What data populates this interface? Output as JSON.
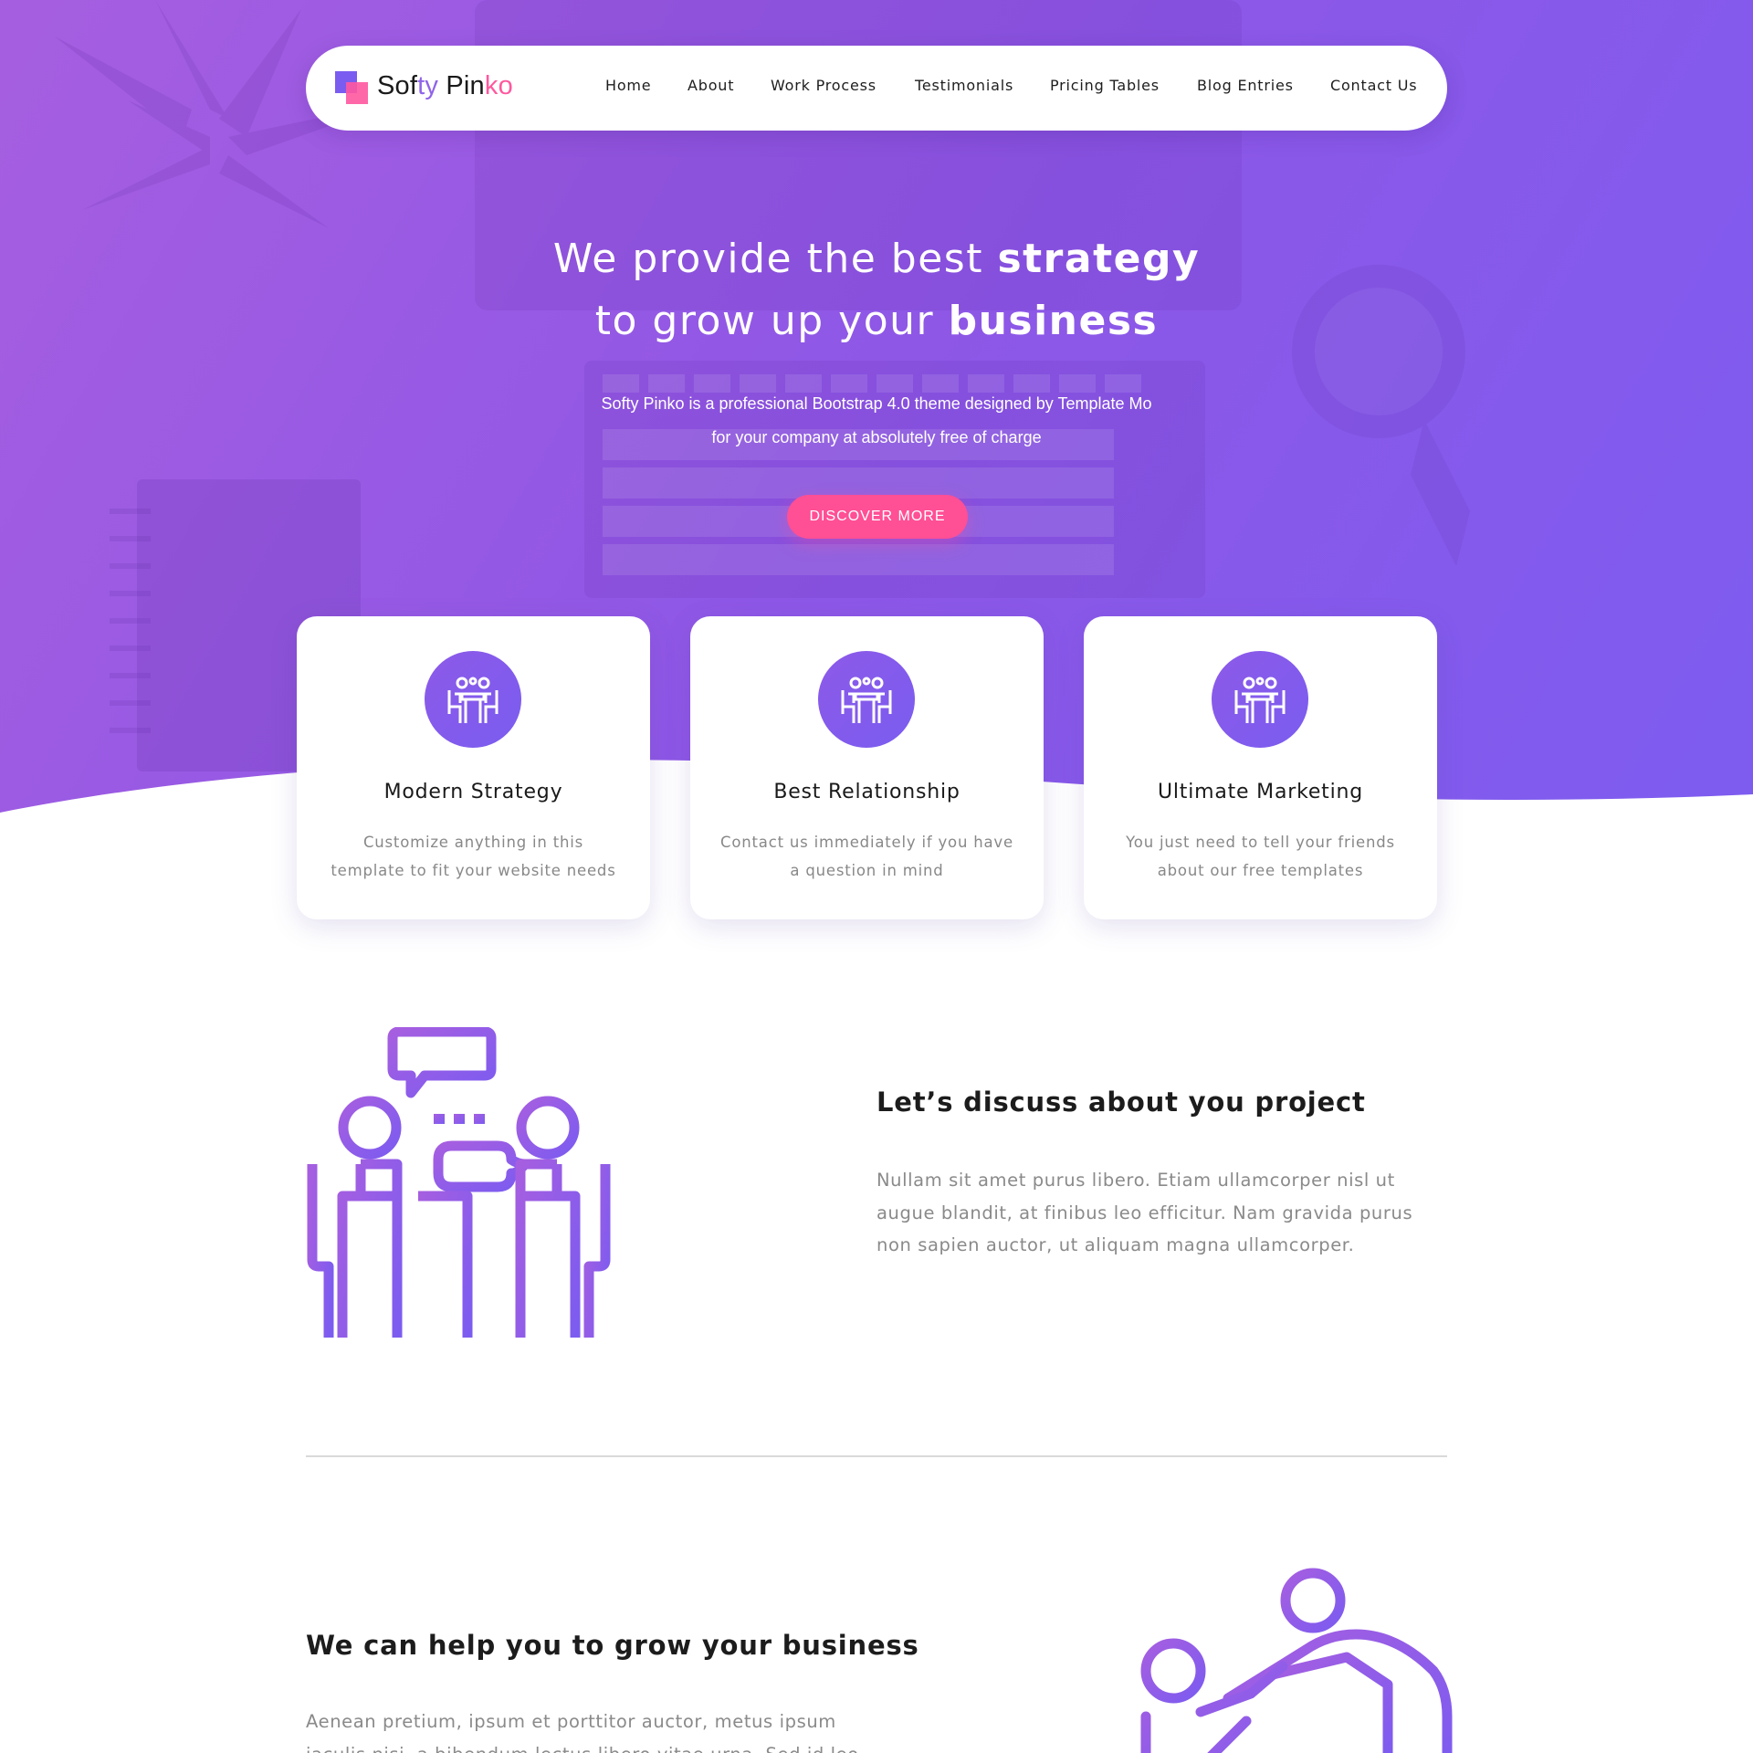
{
  "brand": {
    "name_part1": "Sof",
    "name_part2": "ty",
    "name_part3": " Pin",
    "name_part4": "ko",
    "colors": {
      "primary": "#7a5cf0",
      "accent": "#ff589e",
      "purple": "#a65ee0"
    }
  },
  "nav": {
    "items": [
      {
        "label": "Home"
      },
      {
        "label": "About"
      },
      {
        "label": "Work Process"
      },
      {
        "label": "Testimonials"
      },
      {
        "label": "Pricing Tables"
      },
      {
        "label": "Blog Entries"
      },
      {
        "label": "Contact Us"
      }
    ]
  },
  "hero": {
    "title_line1_regular": "We provide the best ",
    "title_line1_bold": "strategy",
    "title_line2_regular": "to grow up your ",
    "title_line2_bold": "business",
    "subtitle_line1": "Softy Pinko is a professional Bootstrap 4.0 theme designed by Template Mo",
    "subtitle_line2": "for your company at absolutely free of charge",
    "cta_label": "DISCOVER MORE"
  },
  "features": [
    {
      "icon": "meeting-icon",
      "title": "Modern Strategy",
      "text_line1": "Customize anything in this",
      "text_line2": "template to fit your website needs"
    },
    {
      "icon": "meeting-icon",
      "title": "Best Relationship",
      "text_line1": "Contact us immediately if you have",
      "text_line2": "a question in mind"
    },
    {
      "icon": "meeting-icon",
      "title": "Ultimate Marketing",
      "text_line1": "You just need to tell your friends",
      "text_line2": "about our free templates"
    }
  ],
  "discuss": {
    "heading": "Let’s discuss about you project",
    "text": "Nullam sit amet purus libero. Etiam ullamcorper nisl ut augue blandit, at finibus leo efficitur. Nam gravida purus non sapien auctor, ut aliquam magna ullamcorper.",
    "illustration": "people-discussion-icon"
  },
  "grow": {
    "heading": "We can help you to grow your business",
    "text": "Aenean pretium, ipsum et porttitor auctor, metus ipsum iaculis nisi, a bibendum lectus libero vitae urna. Sed id leo",
    "illustration": "teamwork-icon"
  }
}
